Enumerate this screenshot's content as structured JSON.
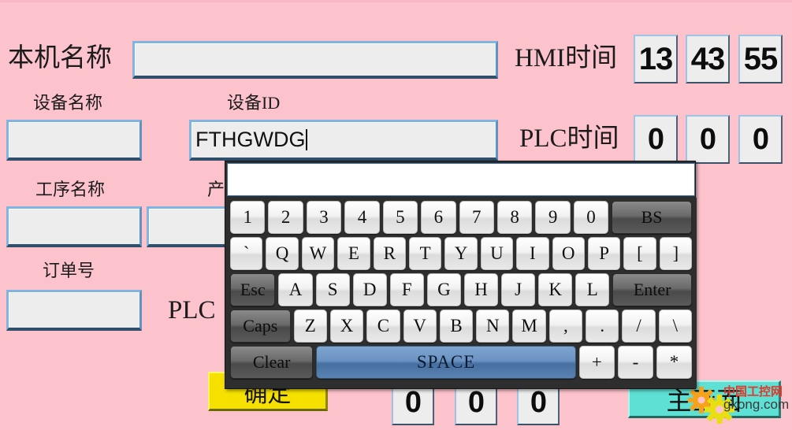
{
  "screen": {
    "background_color": "#FDC3CD"
  },
  "form": {
    "machine_name": {
      "label": "本机名称",
      "value": ""
    },
    "device_name": {
      "label": "设备名称",
      "value": ""
    },
    "device_id": {
      "label": "设备ID",
      "value": "FTHGWDG"
    },
    "process_name": {
      "label": "工序名称",
      "value": ""
    },
    "product_name": {
      "label": "产",
      "value": ""
    },
    "order_no": {
      "label": "订单号",
      "value": ""
    }
  },
  "clock": {
    "hmi": {
      "label": "HMI时间",
      "hour": "13",
      "minute": "43",
      "second": "55"
    },
    "plc": {
      "label": "PLC时间",
      "hour": "0",
      "minute": "0",
      "second": "0"
    },
    "plc_set": {
      "label": "PLC",
      "hour": "0",
      "minute": "0",
      "second": "0"
    }
  },
  "buttons": {
    "confirm": "确定",
    "main_screen": "主画面"
  },
  "watermark": {
    "cn": "中国工控网",
    "en": "gkong.com"
  },
  "keyboard": {
    "display_value": "",
    "rows": [
      [
        {
          "label": "1",
          "style": "light",
          "name": "key-1"
        },
        {
          "label": "2",
          "style": "light",
          "name": "key-2"
        },
        {
          "label": "3",
          "style": "light",
          "name": "key-3"
        },
        {
          "label": "4",
          "style": "light",
          "name": "key-4"
        },
        {
          "label": "5",
          "style": "light",
          "name": "key-5"
        },
        {
          "label": "6",
          "style": "light",
          "name": "key-6"
        },
        {
          "label": "7",
          "style": "light",
          "name": "key-7"
        },
        {
          "label": "8",
          "style": "light",
          "name": "key-8"
        },
        {
          "label": "9",
          "style": "light",
          "name": "key-9"
        },
        {
          "label": "0",
          "style": "light",
          "name": "key-0"
        },
        {
          "label": "BS",
          "style": "dark",
          "width": "wide-bs",
          "name": "key-backspace"
        }
      ],
      [
        {
          "label": "`",
          "style": "light",
          "name": "key-backtick"
        },
        {
          "label": "Q",
          "style": "light",
          "name": "key-q"
        },
        {
          "label": "W",
          "style": "light",
          "name": "key-w"
        },
        {
          "label": "E",
          "style": "light",
          "name": "key-e"
        },
        {
          "label": "R",
          "style": "light",
          "name": "key-r"
        },
        {
          "label": "T",
          "style": "light",
          "name": "key-t"
        },
        {
          "label": "Y",
          "style": "light",
          "name": "key-y"
        },
        {
          "label": "U",
          "style": "light",
          "name": "key-u"
        },
        {
          "label": "I",
          "style": "light",
          "name": "key-i"
        },
        {
          "label": "O",
          "style": "light",
          "name": "key-o"
        },
        {
          "label": "P",
          "style": "light",
          "name": "key-p"
        },
        {
          "label": "[",
          "style": "light",
          "name": "key-bracket-left"
        },
        {
          "label": "]",
          "style": "light",
          "name": "key-bracket-right"
        }
      ],
      [
        {
          "label": "Esc",
          "style": "dark",
          "width": "wide-esc",
          "name": "key-escape"
        },
        {
          "label": "A",
          "style": "light",
          "name": "key-a"
        },
        {
          "label": "S",
          "style": "light",
          "name": "key-s"
        },
        {
          "label": "D",
          "style": "light",
          "name": "key-d"
        },
        {
          "label": "F",
          "style": "light",
          "name": "key-f"
        },
        {
          "label": "G",
          "style": "light",
          "name": "key-g"
        },
        {
          "label": "H",
          "style": "light",
          "name": "key-h"
        },
        {
          "label": "J",
          "style": "light",
          "name": "key-j"
        },
        {
          "label": "K",
          "style": "light",
          "name": "key-k"
        },
        {
          "label": "L",
          "style": "light",
          "name": "key-l"
        },
        {
          "label": "Enter",
          "style": "dark",
          "width": "wide-enter",
          "name": "key-enter"
        }
      ],
      [
        {
          "label": "Caps",
          "style": "dark",
          "width": "wide-caps",
          "name": "key-caps-lock"
        },
        {
          "label": "Z",
          "style": "light",
          "name": "key-z"
        },
        {
          "label": "X",
          "style": "light",
          "name": "key-x"
        },
        {
          "label": "C",
          "style": "light",
          "name": "key-c"
        },
        {
          "label": "V",
          "style": "light",
          "name": "key-v"
        },
        {
          "label": "B",
          "style": "light",
          "name": "key-b"
        },
        {
          "label": "N",
          "style": "light",
          "name": "key-n"
        },
        {
          "label": "M",
          "style": "light",
          "name": "key-m"
        },
        {
          "label": ",",
          "style": "light",
          "name": "key-comma"
        },
        {
          "label": ".",
          "style": "light",
          "name": "key-period"
        },
        {
          "label": "/",
          "style": "light",
          "name": "key-slash"
        },
        {
          "label": "\\",
          "style": "light",
          "name": "key-backslash"
        }
      ],
      [
        {
          "label": "Clear",
          "style": "dark",
          "width": "wide-clear",
          "name": "key-clear"
        },
        {
          "label": "SPACE",
          "style": "space",
          "width": "wide-space",
          "name": "key-space"
        },
        {
          "label": "+",
          "style": "light",
          "name": "key-plus"
        },
        {
          "label": "-",
          "style": "light",
          "name": "key-minus"
        },
        {
          "label": "*",
          "style": "light",
          "name": "key-asterisk"
        }
      ]
    ]
  }
}
